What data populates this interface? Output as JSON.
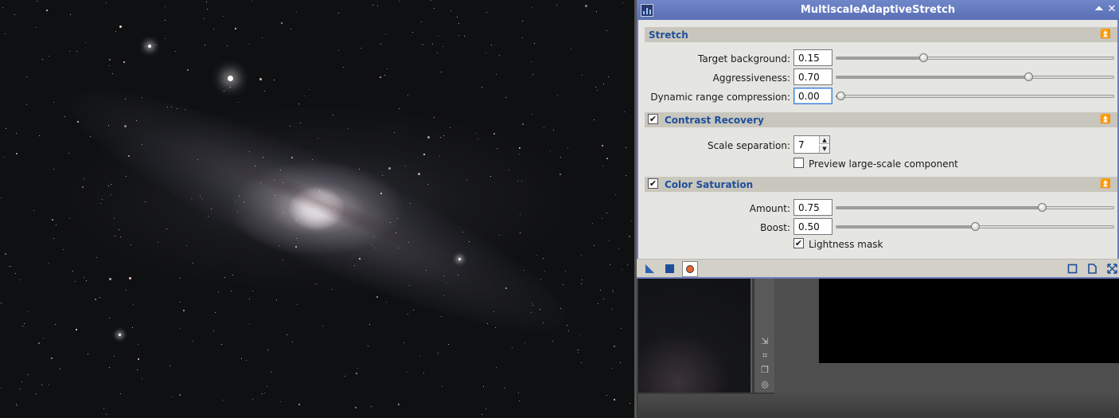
{
  "dialog": {
    "title": "MultiscaleAdaptiveStretch",
    "sections": {
      "stretch": {
        "label": "Stretch",
        "target_background": {
          "label": "Target background:",
          "value": "0.15",
          "fraction": 0.31
        },
        "aggressiveness": {
          "label": "Aggressiveness:",
          "value": "0.70",
          "fraction": 0.7
        },
        "dynamic_range": {
          "label": "Dynamic range compression:",
          "value": "0.00",
          "fraction": 0.0
        }
      },
      "contrast_recovery": {
        "label": "Contrast Recovery",
        "enabled": true,
        "scale_separation": {
          "label": "Scale separation:",
          "value": "7"
        },
        "preview_large_scale": {
          "label": "Preview large-scale component",
          "checked": false
        }
      },
      "color_saturation": {
        "label": "Color Saturation",
        "enabled": true,
        "amount": {
          "label": "Amount:",
          "value": "0.75",
          "fraction": 0.75
        },
        "boost": {
          "label": "Boost:",
          "value": "0.50",
          "fraction": 0.5
        },
        "lightness_mask": {
          "label": "Lightness mask",
          "checked": true
        }
      }
    }
  },
  "icons": {
    "collapse": "double-up-chevron-icon",
    "titlebar_buttons": [
      "shade-icon",
      "close-icon"
    ],
    "footer_left": [
      "new-instance-icon",
      "apply-global-icon",
      "real-time-preview-icon"
    ],
    "footer_right": [
      "reset-icon",
      "documentation-icon",
      "expand-icon"
    ]
  },
  "colors": {
    "titlebar": "#5f74bb",
    "section_header_text": "#1f4f9a",
    "dialog_bg": "#eaeae6"
  }
}
